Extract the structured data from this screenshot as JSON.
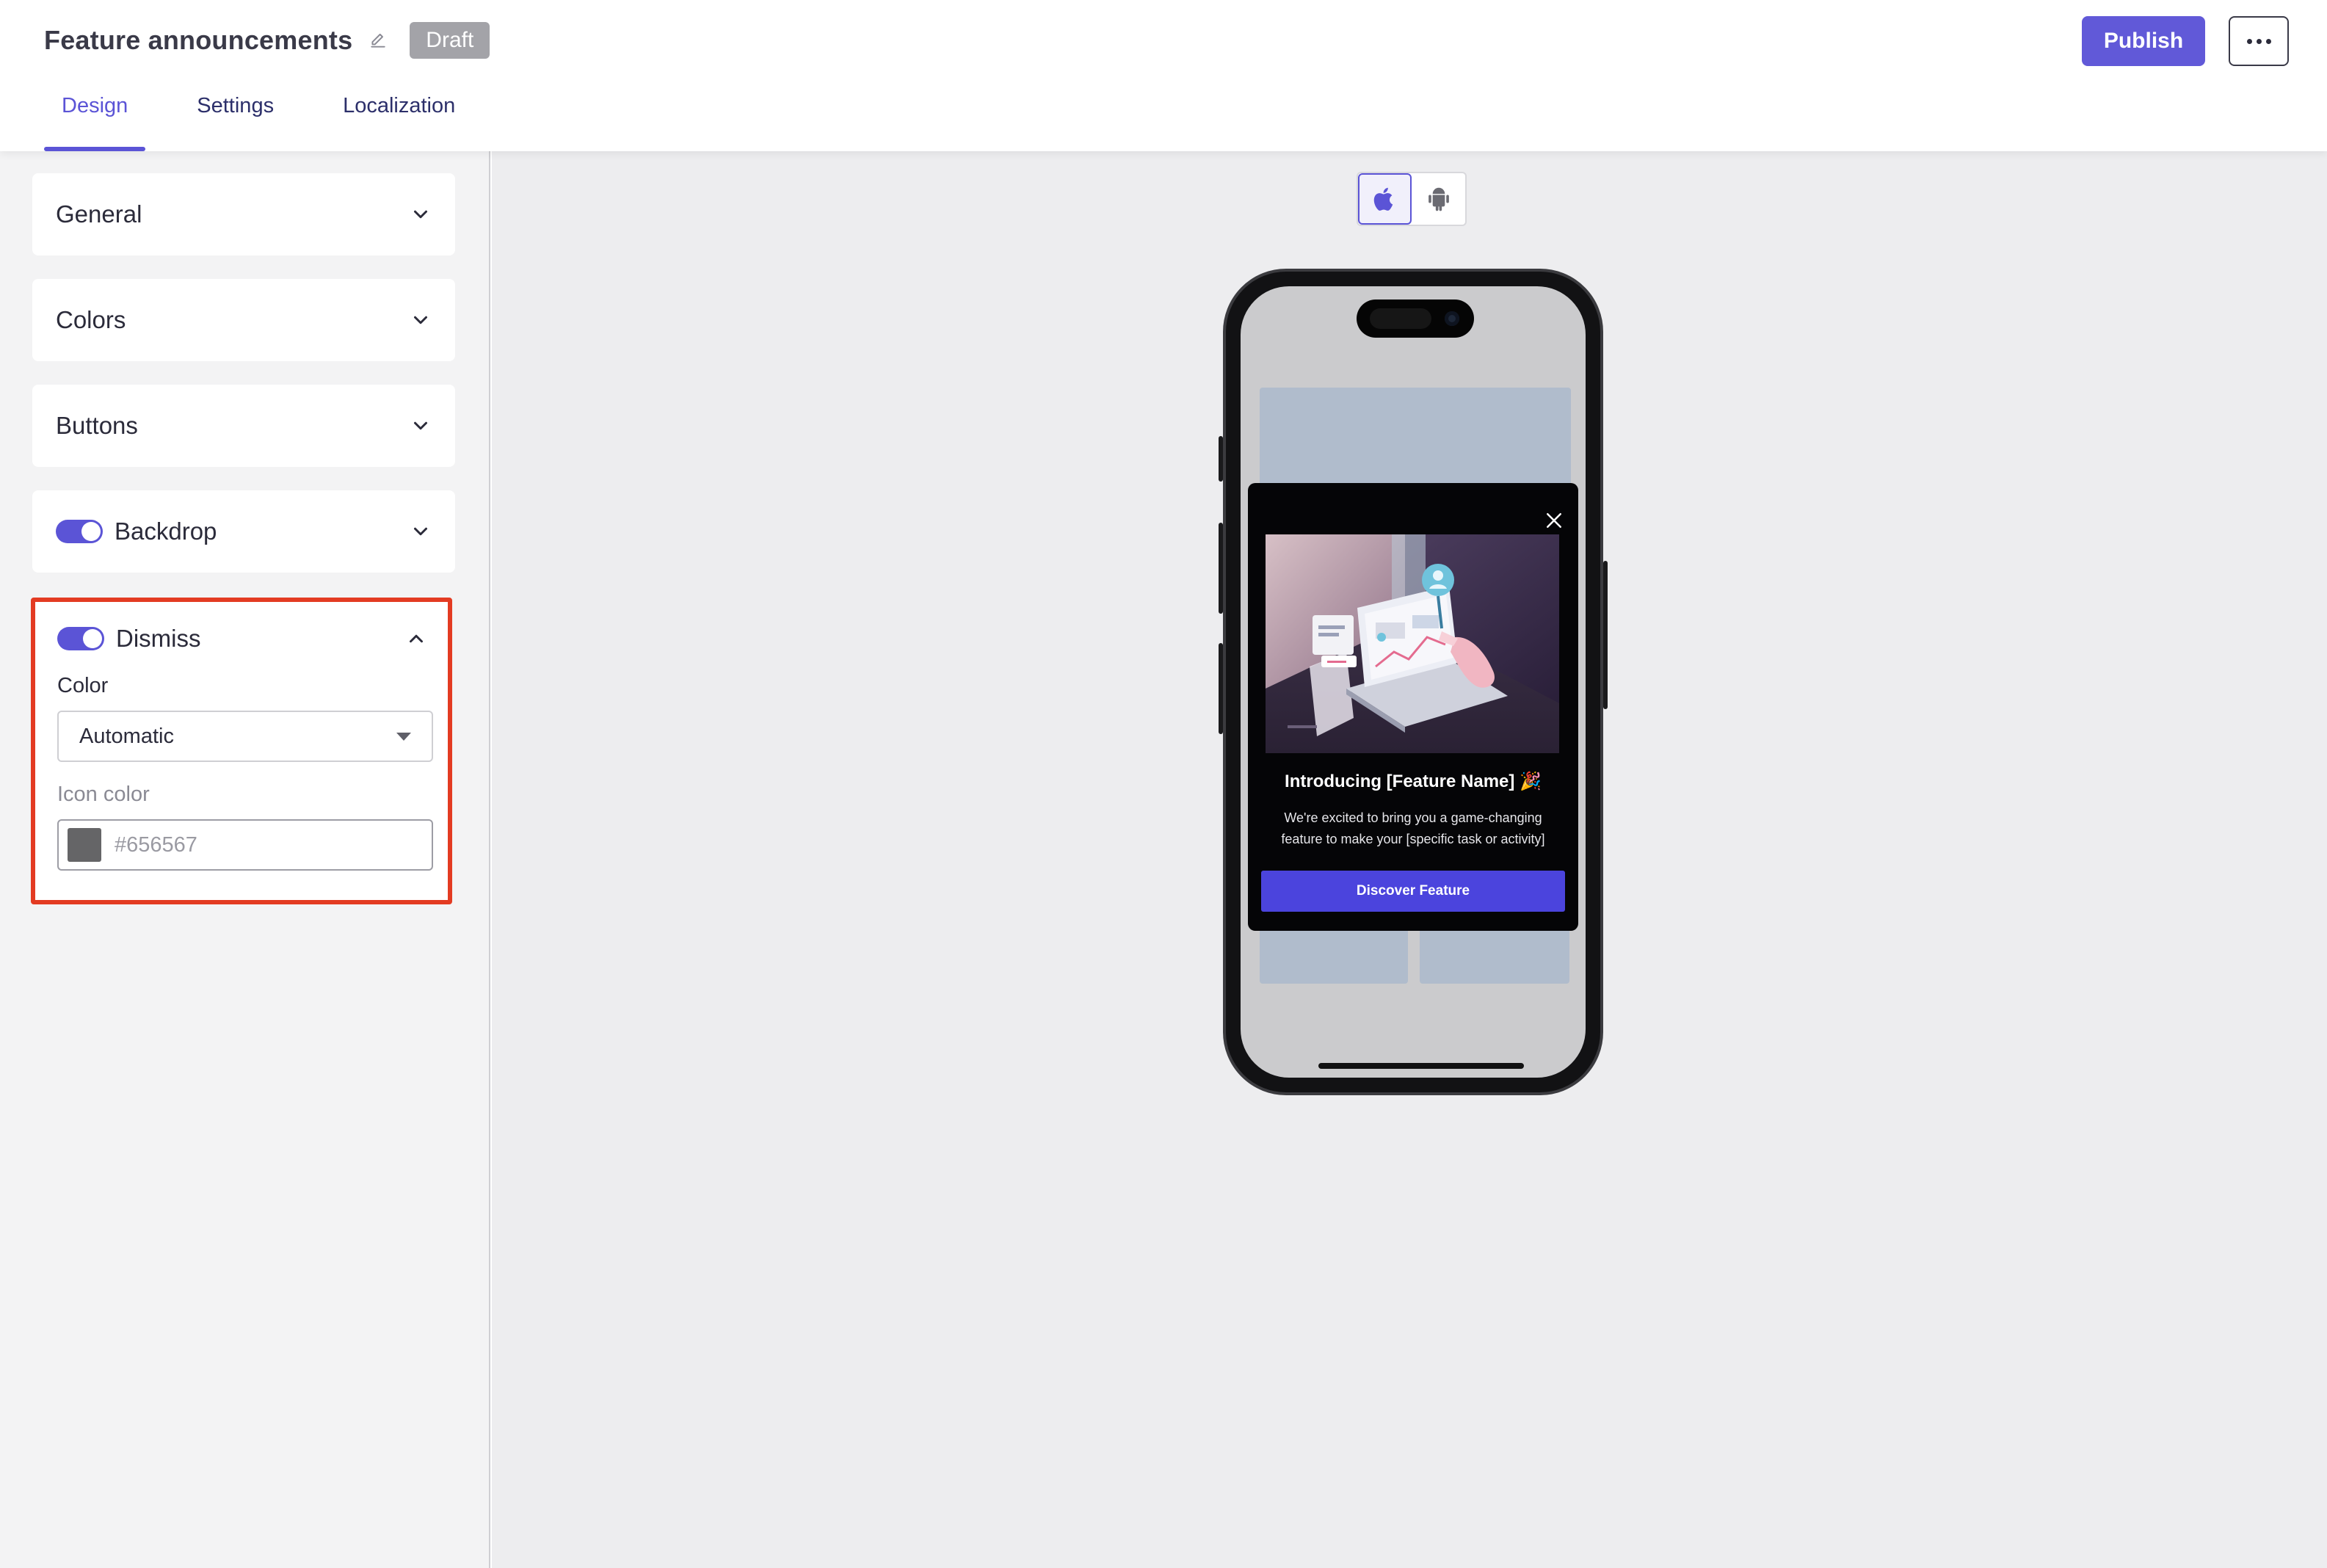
{
  "header": {
    "title": "Feature announcements",
    "status_badge": "Draft",
    "publish_label": "Publish",
    "tabs": [
      {
        "label": "Design",
        "active": true
      },
      {
        "label": "Settings",
        "active": false
      },
      {
        "label": "Localization",
        "active": false
      }
    ]
  },
  "sidebar": {
    "sections": [
      {
        "label": "General",
        "expanded": false,
        "toggle": null
      },
      {
        "label": "Colors",
        "expanded": false,
        "toggle": null
      },
      {
        "label": "Buttons",
        "expanded": false,
        "toggle": null
      },
      {
        "label": "Backdrop",
        "expanded": false,
        "toggle": true
      }
    ],
    "dismiss": {
      "label": "Dismiss",
      "toggle": true,
      "expanded": true,
      "color_label": "Color",
      "color_value": "Automatic",
      "icon_color_label": "Icon color",
      "icon_color_placeholder": "#656567",
      "icon_color_swatch": "#656567"
    }
  },
  "preview": {
    "platforms": [
      {
        "name": "apple-icon",
        "active": true
      },
      {
        "name": "android-icon",
        "active": false
      }
    ],
    "modal": {
      "title": "Introducing [Feature Name] 🎉",
      "body": "We're excited to bring you a game-changing feature to make your [specific task or activity]",
      "cta_label": "Discover Feature"
    }
  },
  "colors": {
    "accent": "#5b54d6",
    "publish": "#6159d8",
    "highlight_border": "#e33b22",
    "modal_cta": "#4b44dd",
    "placeholder_block": "#b0bccc"
  }
}
